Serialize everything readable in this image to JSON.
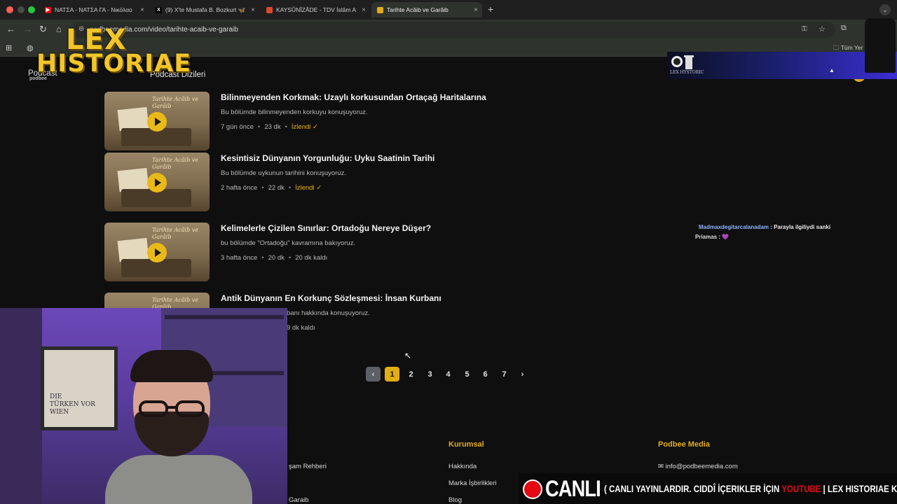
{
  "browser": {
    "tabs": [
      {
        "label": "ΝΑΤΣΑ - ΝΑΤΣΑ ΓΑ - Νικόλαο",
        "icon": "youtube-icon"
      },
      {
        "label": "(9) X'te Mustafa B. Bozkurt 🦋",
        "icon": "x-icon"
      },
      {
        "label": "KAYSÛNÎZÂDE - TDV İslâm A",
        "icon": "tdv-icon"
      },
      {
        "label": "Tarihte Acâib ve Garâib",
        "icon": "podbee-icon"
      }
    ],
    "close_glyph": "×",
    "new_tab_glyph": "+",
    "url": "podbeemedia.com/video/tarihte-acaib-ve-garaib",
    "bookmarks_all": "Tüm Yer"
  },
  "site": {
    "nav_left": "Podcast",
    "logo": "podbee",
    "nav_series": "Podcast Dizileri"
  },
  "episodes": [
    {
      "title": "Bilinmeyenden Korkmak: Uzaylı korkusundan Ortaçağ Haritalarına",
      "desc": "Bu bölümde bilinmeyenden korkuyu konuşuyoruz.",
      "age": "7 gün önce",
      "duration": "23 dk",
      "status": "İzlendi ✓",
      "watched": true
    },
    {
      "title": "Kesintisiz Dünyanın Yorgunluğu: Uyku Saatinin Tarihi",
      "desc": "Bu bölümde uykunun tarihini konuşuyoruz.",
      "age": "2 hafta önce",
      "duration": "22 dk",
      "status": "İzlendi ✓",
      "watched": true
    },
    {
      "title": "Kelimelerle Çizilen Sınırlar: Ortadoğu Nereye Düşer?",
      "desc": "bu bölümde \"Ortadoğu\" kavramına bakıyoruz.",
      "age": "3 hafta önce",
      "duration": "20 dk",
      "status": "20 dk kaldı",
      "watched": false
    },
    {
      "title": "Antik Dünyanın En Korkunç Sözleşmesi: İnsan Kurbanı",
      "desc": "banı hakkında konuşuyoruz.",
      "age": "",
      "duration": "",
      "status": "9 dk kaldı",
      "watched": false
    }
  ],
  "thumb_title": "Tarihte Acâib ve Garâib",
  "pagination": {
    "prev": "‹",
    "pages": [
      "1",
      "2",
      "3",
      "4",
      "5",
      "6",
      "7"
    ],
    "current": "1",
    "next": "›"
  },
  "footer": {
    "col1": {
      "links": [
        "şam Rehberi",
        "?",
        "Garaib"
      ]
    },
    "col2": {
      "heading": "Kurumsal",
      "links": [
        "Hakkında",
        "Marka İşbirlikleri",
        "Blog"
      ]
    },
    "col3": {
      "heading": "Podbee Media",
      "email": "info@podbeemedia.com"
    }
  },
  "overlay": {
    "brand_line1": "LEX",
    "brand_line2": "HISTORIAE",
    "stream_name": "LEX HYSTORIC",
    "chat": [
      {
        "user": "Madmaxdegitarcalanadam",
        "msg": " : Parayla ilgiliydi sanki"
      },
      {
        "user": "Priamas",
        "msg": " :  💜"
      }
    ],
    "poster_text": [
      "DIE",
      "TÜRKEN VOR",
      "WIEN"
    ],
    "ticker_live": "CANLI",
    "ticker_part1": "( CANLI YAYINLARDIR. CIDDÎ İÇERIKLER İÇIN ",
    "ticker_yt": "YOUTUBE",
    "ticker_part2": " | LEX HISTORIAE KA"
  },
  "colors": {
    "accent": "#e2ad16",
    "watched": "#e9b31c",
    "live": "#e50914"
  }
}
